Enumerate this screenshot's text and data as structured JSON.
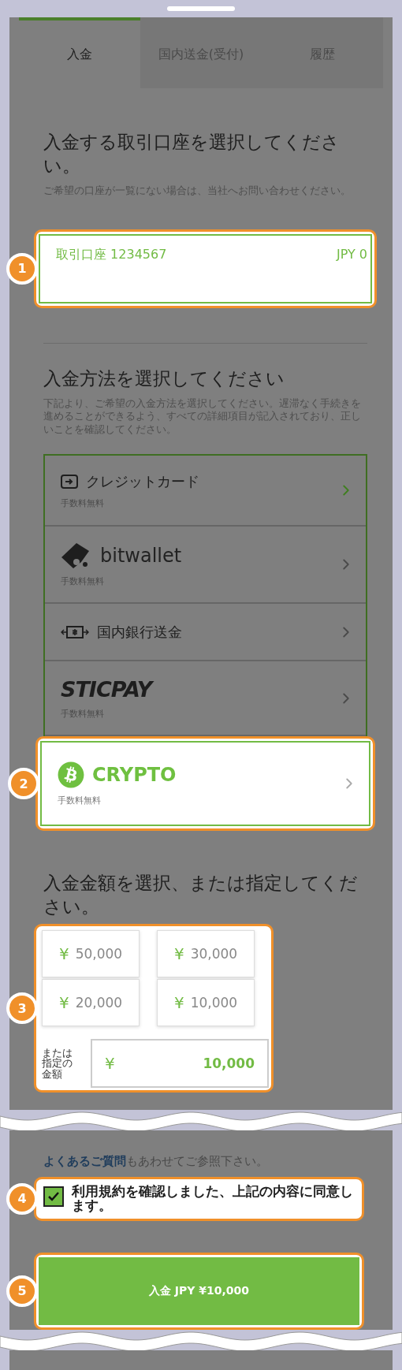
{
  "tabs": [
    {
      "label": "入金",
      "selected": true
    },
    {
      "label": "国内送金(受付)",
      "selected": false
    },
    {
      "label": "履歴",
      "selected": false
    }
  ],
  "account_section": {
    "title": "入金する取引口座を選択してください。",
    "note": "ご希望の口座が一覧にない場合は、当社へお問い合わせください。",
    "step": "1",
    "account": {
      "name": "取引口座 1234567",
      "balance": "JPY 0",
      "selected": true
    }
  },
  "method_section": {
    "title": "入金方法を選択してください",
    "description": "下記より、ご希望の入金方法を選択してください。遅滞なく手続きを進めることができるよう、すべての詳細項目が記入されており、正しいことを確認してください。",
    "step": "2",
    "methods": [
      {
        "kind": "card",
        "label": "クレジットカード",
        "fee": "手数料無料",
        "hovered": true,
        "highlighted": false
      },
      {
        "kind": "bitwallet",
        "label": "bitwallet",
        "fee": "手数料無料",
        "hovered": false,
        "highlighted": false
      },
      {
        "kind": "bank",
        "label": "国内銀行送金",
        "hovered": false,
        "highlighted": false
      },
      {
        "kind": "sticpay",
        "label": "STICPAY",
        "fee": "手数料無料",
        "hovered": false,
        "highlighted": false
      },
      {
        "kind": "crypto",
        "label": "CRYPTO",
        "fee": "手数料無料",
        "hovered": false,
        "highlighted": true
      }
    ]
  },
  "amount_section": {
    "title": "入金金額を選択、または指定してください。",
    "step": "3",
    "presets": [
      {
        "currency": "¥",
        "amount": "50,000"
      },
      {
        "currency": "¥",
        "amount": "30,000"
      },
      {
        "currency": "¥",
        "amount": "20,000"
      },
      {
        "currency": "¥",
        "amount": "10,000"
      }
    ],
    "custom": {
      "label": "または指定の金額",
      "currency": "¥",
      "value": "10,000"
    }
  },
  "faq": {
    "link": "よくあるご質問",
    "text": "もあわせてご参照下さい。"
  },
  "agreement": {
    "label": "利用規約を確認しました、上記の内容に同意します。",
    "checked": true,
    "step": "4"
  },
  "submit": {
    "label": "入金 JPY ¥10,000",
    "step": "5"
  }
}
